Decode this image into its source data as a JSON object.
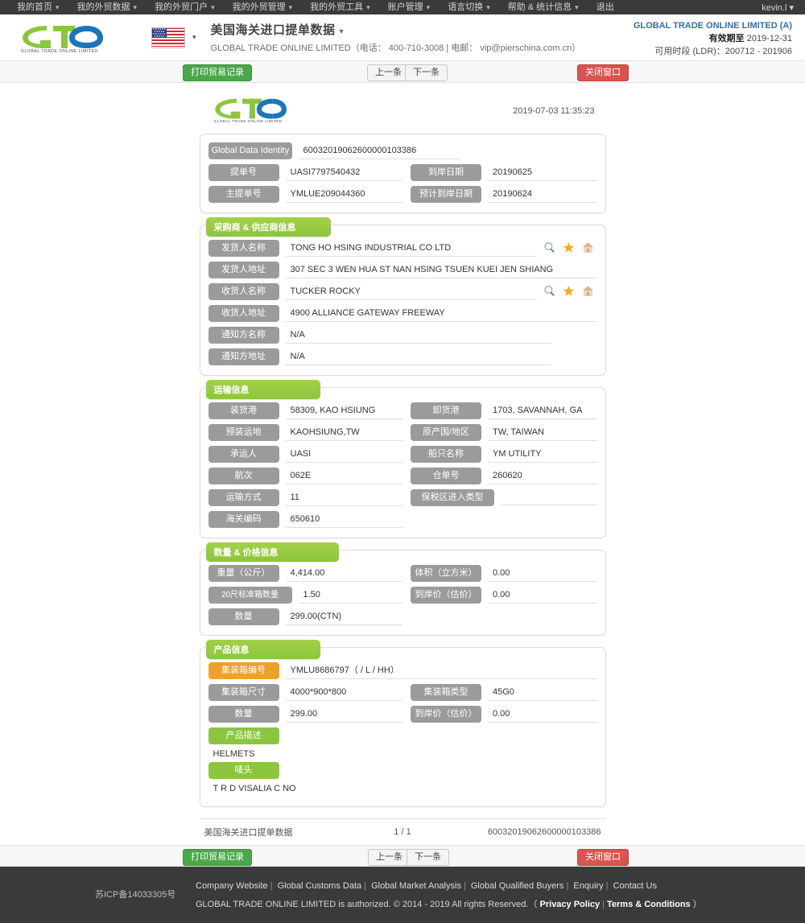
{
  "topnav": {
    "items": [
      {
        "label": "我的首页",
        "caret": "▾"
      },
      {
        "label": "我的外贸数据",
        "caret": "▾"
      },
      {
        "label": "我的外贸门户",
        "caret": "▾"
      },
      {
        "label": "我的外贸管理",
        "caret": "▾"
      },
      {
        "label": "我的外贸工具",
        "caret": "▾"
      },
      {
        "label": "账户管理",
        "caret": "▾"
      },
      {
        "label": "语言切换",
        "caret": "▾"
      },
      {
        "label": "帮助 & 统计信息",
        "caret": "▾"
      },
      {
        "label": "退出",
        "caret": ""
      }
    ],
    "user": "kevin.l ▾"
  },
  "header": {
    "logo_text": "GLOBAL TRADE ONLINE LIMITED",
    "flag_name": "us-flag-icon",
    "flag_caret": "▾",
    "title": "美国海关进口提单数据",
    "title_caret": "▾",
    "subtitle": "GLOBAL TRADE ONLINE LIMITED（电话： 400-710-3008 | 电邮： vip@pierschina.com.cn）",
    "account_name": "GLOBAL TRADE ONLINE LIMITED (A)",
    "valid_label": "有效期至",
    "valid_value": "2019-12-31",
    "ldr_text": "可用时段 (LDR)：200712 - 201906"
  },
  "toolbar": {
    "print_label": "打印贸易记录",
    "prev_label": "上一条",
    "next_label": "下一条",
    "close_label": "关闭窗口"
  },
  "document": {
    "timestamp": "2019-07-03 11:35:23",
    "identity": {
      "label": "Global Data Identity",
      "value": "60032019062600000103386"
    },
    "top_fields": [
      {
        "label": "提单号",
        "value": "UASI7797540432"
      },
      {
        "label": "到岸日期",
        "value": "20190625"
      },
      {
        "label": "主提单号",
        "value": "YMLUE209044360"
      },
      {
        "label": "预计到岸日期",
        "value": "20190624"
      }
    ],
    "parties": {
      "section_title": "采购商 & 供应商信息",
      "rows": [
        {
          "label": "发货人名称",
          "value": "TONG HO HSING INDUSTRIAL CO LTD",
          "icons": true
        },
        {
          "label": "发货人地址",
          "value": "307 SEC 3 WEN HUA ST NAN HSING TSUEN KUEI JEN SHIANG",
          "icons": false
        },
        {
          "label": "收货人名称",
          "value": "TUCKER ROCKY",
          "icons": true
        },
        {
          "label": "收货人地址",
          "value": "4900 ALLIANCE GATEWAY FREEWAY",
          "icons": false
        },
        {
          "label": "通知方名称",
          "value": "N/A",
          "icons": false
        },
        {
          "label": "通知方地址",
          "value": "N/A",
          "icons": false
        }
      ],
      "icon_names": [
        "search-icon",
        "star-icon",
        "home-icon"
      ]
    },
    "transport": {
      "section_title": "运输信息",
      "rows": [
        [
          {
            "label": "装货港",
            "value": "58309, KAO HSIUNG"
          },
          {
            "label": "卸货港",
            "value": "1703, SAVANNAH, GA"
          }
        ],
        [
          {
            "label": "预装运地",
            "value": "KAOHSIUNG,TW"
          },
          {
            "label": "原产国/地区",
            "value": "TW, TAIWAN"
          }
        ],
        [
          {
            "label": "承运人",
            "value": "UASI"
          },
          {
            "label": "船只名称",
            "value": "YM UTILITY"
          }
        ],
        [
          {
            "label": "航次",
            "value": "062E"
          },
          {
            "label": "仓单号",
            "value": "260620"
          }
        ],
        [
          {
            "label": "运输方式",
            "value": "11"
          },
          {
            "label": "保税区进入类型",
            "value": ""
          }
        ],
        [
          {
            "label": "海关编码",
            "value": "650610"
          }
        ]
      ]
    },
    "quantity": {
      "section_title": "数量 & 价格信息",
      "rows": [
        [
          {
            "label": "重量（公斤）",
            "value": "4,414.00"
          },
          {
            "label": "体积（立方米）",
            "value": "0.00"
          }
        ],
        [
          {
            "label": "20尺标准箱数量",
            "value": "1.50"
          },
          {
            "label": "到岸价（估价）",
            "value": "0.00"
          }
        ],
        [
          {
            "label": "数量",
            "value": "299.00(CTN)"
          }
        ]
      ]
    },
    "product": {
      "section_title": "产品信息",
      "container_no_label": "集装箱编号",
      "container_no_value": "YMLU8686797（ / L / HH）",
      "rows": [
        [
          {
            "label": "集装箱尺寸",
            "value": "4000*900*800"
          },
          {
            "label": "集装箱类型",
            "value": "45G0"
          }
        ],
        [
          {
            "label": "数量",
            "value": "299.00"
          },
          {
            "label": "到岸价（估价）",
            "value": "0.00"
          }
        ]
      ],
      "desc_label": "产品描述",
      "desc_value": "HELMETS",
      "mark_label": "唛头",
      "mark_value": "T R D VISALIA C NO"
    },
    "footer": {
      "source": "美国海关进口提单数据",
      "page": "1 / 1",
      "identity": "60032019062600000103386"
    }
  },
  "footer": {
    "icp": "苏ICP备14033305号",
    "links": [
      "Company Website",
      "Global Customs Data",
      "Global Market Analysis",
      "Global Qualified Buyers",
      "Enquiry",
      "Contact Us"
    ],
    "copyright_pre": "GLOBAL TRADE ONLINE LIMITED is authorized. © 2014 - 2019 All rights Reserved.（",
    "privacy": "Privacy Policy",
    "terms": "Terms & Conditions",
    "copyright_post": "）",
    "separator": "|"
  }
}
